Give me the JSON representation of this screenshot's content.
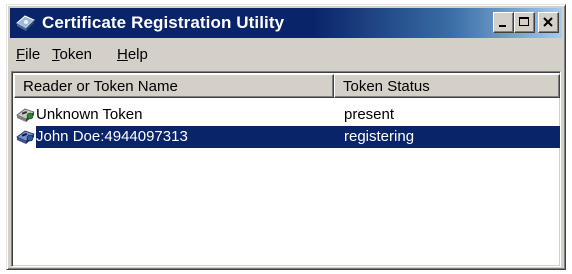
{
  "window": {
    "title": "Certificate Registration Utility"
  },
  "menu": {
    "file": {
      "mnemonic": "F",
      "rest": "ile"
    },
    "token": {
      "mnemonic": "T",
      "rest": "oken"
    },
    "help": {
      "mnemonic": "H",
      "rest": "elp"
    }
  },
  "list": {
    "columns": [
      "Reader or Token Name",
      "Token Status"
    ],
    "rows": [
      {
        "name": "Unknown Token",
        "status": "present",
        "selected": false,
        "icon": "token-reader-icon"
      },
      {
        "name": "John Doe:4944097313",
        "status": "registering",
        "selected": true,
        "icon": "token-reader-icon"
      }
    ]
  },
  "colors": {
    "title_bar": "#0a246a",
    "selection": "#0a246a",
    "face": "#d4d0c8"
  }
}
